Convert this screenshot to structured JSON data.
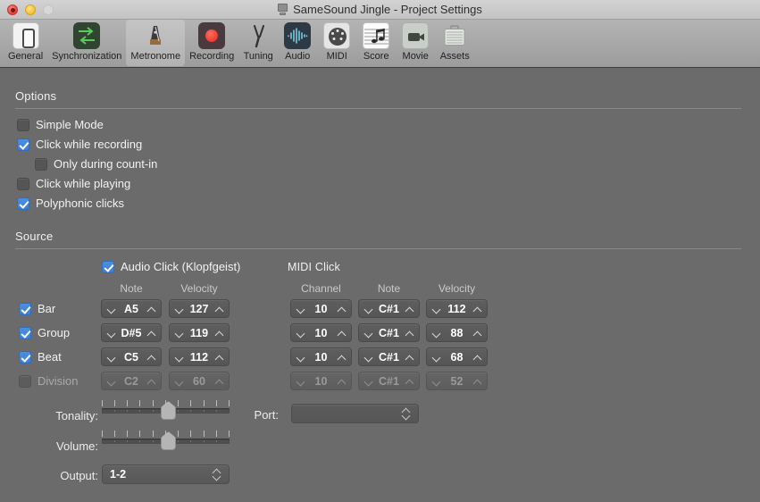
{
  "window": {
    "title": "SameSound Jingle - Project Settings",
    "controls": {
      "close": "close",
      "minimize": "minimize",
      "maximize": "maximize"
    }
  },
  "toolbar": {
    "items": [
      {
        "label": "General",
        "icon": "general-icon",
        "selected": false
      },
      {
        "label": "Synchronization",
        "icon": "synchronization-icon",
        "selected": false
      },
      {
        "label": "Metronome",
        "icon": "metronome-icon",
        "selected": true
      },
      {
        "label": "Recording",
        "icon": "recording-icon",
        "selected": false
      },
      {
        "label": "Tuning",
        "icon": "tuning-icon",
        "selected": false
      },
      {
        "label": "Audio",
        "icon": "audio-icon",
        "selected": false
      },
      {
        "label": "MIDI",
        "icon": "midi-icon",
        "selected": false
      },
      {
        "label": "Score",
        "icon": "score-icon",
        "selected": false
      },
      {
        "label": "Movie",
        "icon": "movie-icon",
        "selected": false
      },
      {
        "label": "Assets",
        "icon": "assets-icon",
        "selected": false
      }
    ]
  },
  "options": {
    "heading": "Options",
    "checkboxes": [
      {
        "label": "Simple Mode",
        "checked": false,
        "indented": false,
        "enabled": true
      },
      {
        "label": "Click while recording",
        "checked": true,
        "indented": false,
        "enabled": true
      },
      {
        "label": "Only during count-in",
        "checked": false,
        "indented": true,
        "enabled": true
      },
      {
        "label": "Click while playing",
        "checked": false,
        "indented": false,
        "enabled": true
      },
      {
        "label": "Polyphonic clicks",
        "checked": true,
        "indented": false,
        "enabled": true
      }
    ]
  },
  "source": {
    "heading": "Source",
    "audio_click": {
      "label": "Audio Click (Klopfgeist)",
      "checked": true
    },
    "midi_click": {
      "label": "MIDI Click"
    },
    "audio_headers": [
      "Note",
      "Velocity"
    ],
    "midi_headers": [
      "Channel",
      "Note",
      "Velocity"
    ],
    "rows": [
      {
        "label": "Bar",
        "checked": true,
        "enabled": true,
        "audio_note": "A5",
        "audio_velocity": "127",
        "midi_channel": "10",
        "midi_note": "C#1",
        "midi_velocity": "112"
      },
      {
        "label": "Group",
        "checked": true,
        "enabled": true,
        "audio_note": "D#5",
        "audio_velocity": "119",
        "midi_channel": "10",
        "midi_note": "C#1",
        "midi_velocity": "88"
      },
      {
        "label": "Beat",
        "checked": true,
        "enabled": true,
        "audio_note": "C5",
        "audio_velocity": "112",
        "midi_channel": "10",
        "midi_note": "C#1",
        "midi_velocity": "68"
      },
      {
        "label": "Division",
        "checked": false,
        "enabled": false,
        "audio_note": "C2",
        "audio_velocity": "60",
        "midi_channel": "10",
        "midi_note": "C#1",
        "midi_velocity": "52"
      }
    ]
  },
  "bottom": {
    "tonality_label": "Tonality:",
    "tonality_value": 52,
    "volume_label": "Volume:",
    "volume_value": 52,
    "output_label": "Output:",
    "output_value": "1-2",
    "port_label": "Port:",
    "port_value": ""
  },
  "colors": {
    "accent": "#3a7ed6",
    "content_bg": "#6b6b6b",
    "toolbar_bg": "#a8a8a8",
    "record_red": "#e8392c"
  }
}
